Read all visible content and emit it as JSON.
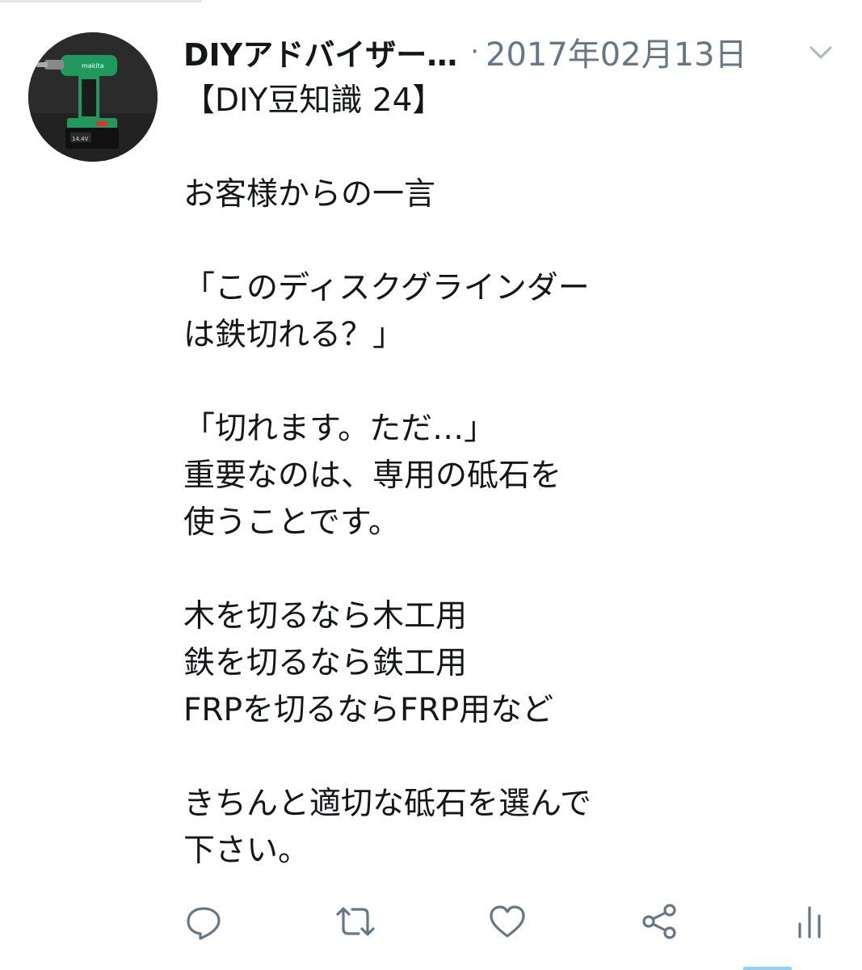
{
  "user": {
    "display_name": "DIYアドバイザー…",
    "separator": "·",
    "timestamp": "2017年02月13日"
  },
  "tweet": {
    "lines": [
      "【DIY豆知識 24】",
      "",
      "お客様からの一言",
      "",
      "「このディスクグラインダー",
      "は鉄切れる？」",
      "",
      "「切れます。ただ…」",
      "重要なのは、専用の砥石を",
      "使うことです。",
      "",
      "木を切るなら木工用",
      "鉄を切るなら鉄工用",
      "FRPを切るならFRP用など",
      "",
      "きちんと適切な砥石を選んで",
      "下さい。"
    ]
  },
  "icons": {
    "avatar": "avatar-drill-photo",
    "caret": "chevron-down-icon",
    "reply": "reply-icon",
    "retweet": "retweet-icon",
    "like": "heart-icon",
    "share": "share-icon",
    "analytics": "analytics-icon"
  },
  "colors": {
    "text": "#14171a",
    "muted": "#657786",
    "icon": "#657786",
    "accent": "#1da1f2"
  }
}
